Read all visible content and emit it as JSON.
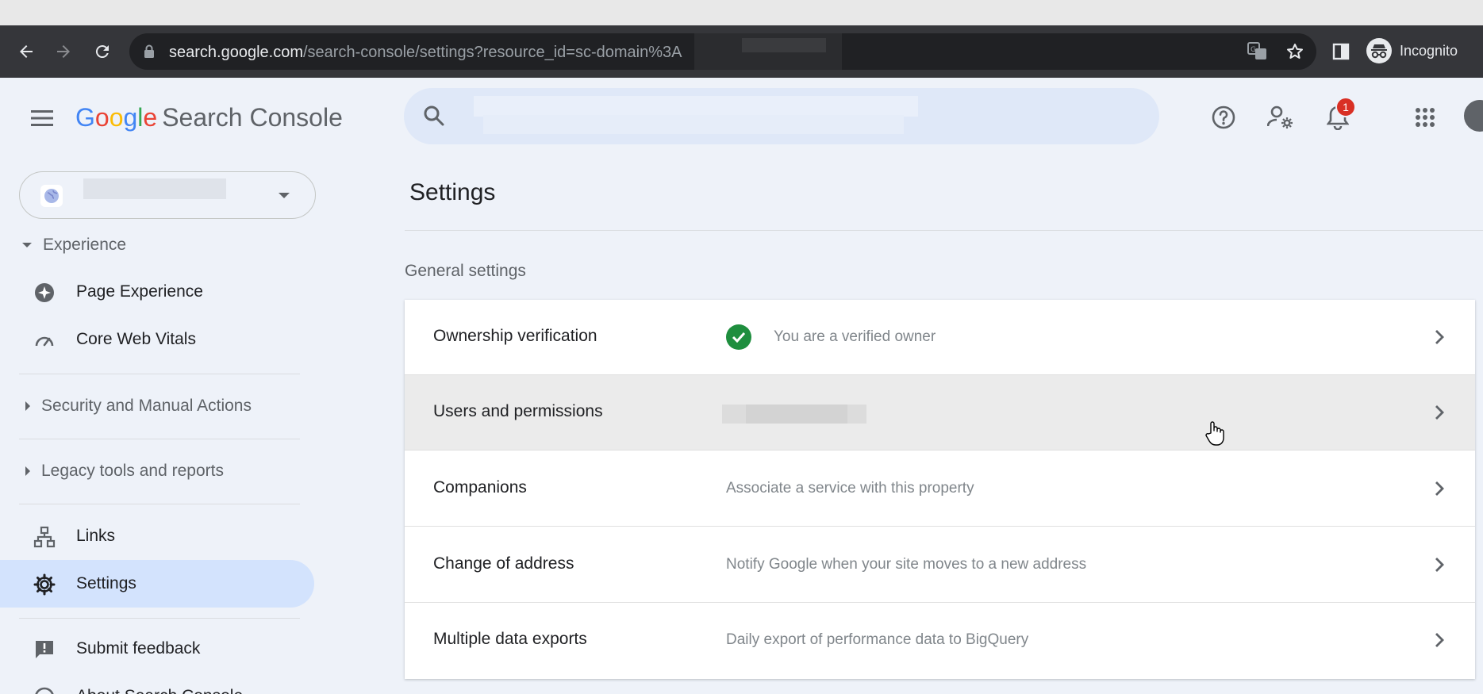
{
  "browser": {
    "url_host": "search.google.com",
    "url_path": "/search-console/settings?resource_id=sc-domain%3A",
    "profile_label": "Incognito"
  },
  "app": {
    "logo_letters": [
      "G",
      "o",
      "o",
      "g",
      "l",
      "e"
    ],
    "product_name": "Search Console",
    "notification_count": "1"
  },
  "sidebar": {
    "experience_header": "Experience",
    "page_experience": "Page Experience",
    "core_web_vitals": "Core Web Vitals",
    "security_header": "Security and Manual Actions",
    "legacy_header": "Legacy tools and reports",
    "links": "Links",
    "settings": "Settings",
    "submit_feedback": "Submit feedback",
    "about": "About Search Console"
  },
  "main": {
    "title": "Settings",
    "section": "General settings",
    "rows": [
      {
        "label": "Ownership verification",
        "desc": "You are a verified owner"
      },
      {
        "label": "Users and permissions",
        "desc": ""
      },
      {
        "label": "Companions",
        "desc": "Associate a service with this property"
      },
      {
        "label": "Change of address",
        "desc": "Notify Google when your site moves to a new address"
      },
      {
        "label": "Multiple data exports",
        "desc": "Daily export of performance data to BigQuery"
      }
    ]
  },
  "colors": {
    "accent_active": "#d3e3fd",
    "verified_green": "#1e8e3e",
    "badge_red": "#d93025"
  }
}
